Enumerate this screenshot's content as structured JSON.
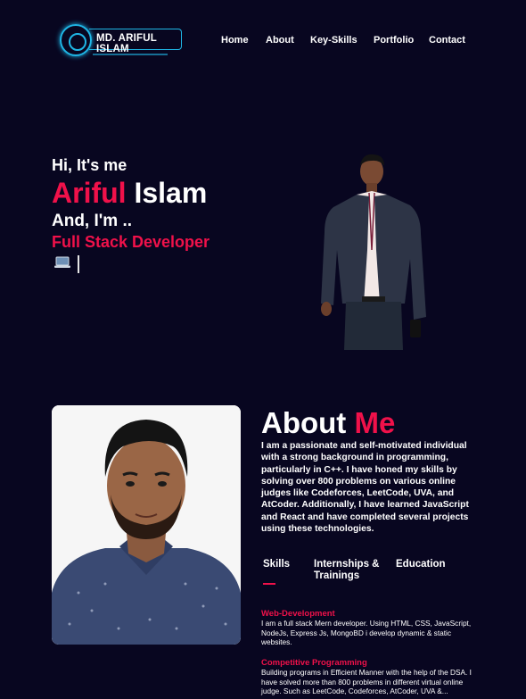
{
  "logo": {
    "text": "MD. ARIFUL ISLAM"
  },
  "nav": {
    "home": "Home",
    "about": "About",
    "skills": "Key-Skills",
    "portfolio": "Portfolio",
    "contact": "Contact"
  },
  "hero": {
    "greeting": "Hi, It's me",
    "first_name": "Ariful",
    "last_name": "Islam",
    "and_im": "And, I'm ..",
    "role": "Full Stack Developer"
  },
  "about": {
    "title_word": "About",
    "title_accent": "Me",
    "text": "I am a passionate and self-motivated individual with a strong background in programming, particularly in C++. I have honed my skills by solving over 800 problems on various online judges like Codeforces, LeetCode, UVA, and AtCoder. Additionally, I have learned JavaScript and React and have completed several projects using these technologies.",
    "tabs": {
      "skills": "Skills",
      "internships": "Internships & Trainings",
      "education": "Education"
    },
    "skills": [
      {
        "title": "Web-Development",
        "desc": "I am a full stack Mern developer. Using HTML, CSS, JavaScript, NodeJs, Express Js, MongoBD i develop dynamic & static websites."
      },
      {
        "title": "Competitive Programming",
        "desc": "Building programs in Efficient Manner with the help of the DSA. I have solved more than 800 problems in different virtual online judge. Such as LeetCode, Codeforces, AtCoder, UVA &..."
      }
    ]
  },
  "colors": {
    "accent": "#f0114a",
    "background": "#080620",
    "logo": "#1fb6e6"
  },
  "icons": {
    "laptop": "laptop-icon"
  }
}
